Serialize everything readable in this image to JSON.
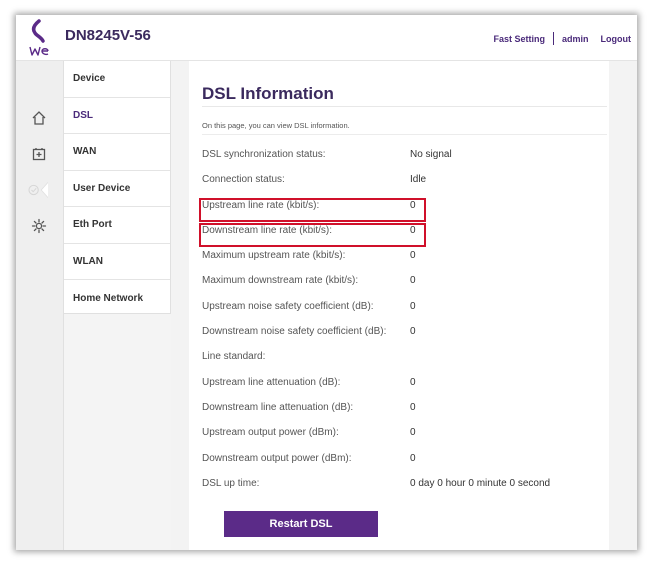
{
  "header": {
    "model": "DN8245V-56",
    "fast_setting": "Fast Setting",
    "user": "admin",
    "logout": "Logout",
    "brand_color": "#5b2b88"
  },
  "rail": {
    "icons": [
      "home-icon",
      "add-device-icon",
      "check-icon",
      "gear-icon"
    ]
  },
  "menu": {
    "items": [
      {
        "label": "Device",
        "active": false
      },
      {
        "label": "DSL",
        "active": true
      },
      {
        "label": "WAN",
        "active": false
      },
      {
        "label": "User Device",
        "active": false
      },
      {
        "label": "Eth Port",
        "active": false
      },
      {
        "label": "WLAN",
        "active": false
      },
      {
        "label": "Home Network",
        "active": false
      }
    ]
  },
  "main": {
    "title": "DSL Information",
    "description": "On this page, you can view DSL information.",
    "rows": [
      {
        "label": "DSL synchronization status:",
        "value": "No signal"
      },
      {
        "label": "Connection status:",
        "value": "Idle"
      },
      {
        "label": "Upstream line rate (kbit/s):",
        "value": "0"
      },
      {
        "label": "Downstream line rate (kbit/s):",
        "value": "0"
      },
      {
        "label": "Maximum upstream rate (kbit/s):",
        "value": "0"
      },
      {
        "label": "Maximum downstream rate (kbit/s):",
        "value": "0"
      },
      {
        "label": "Upstream noise safety coefficient (dB):",
        "value": "0"
      },
      {
        "label": "Downstream noise safety coefficient (dB):",
        "value": "0"
      },
      {
        "label": "Line standard:",
        "value": ""
      },
      {
        "label": "Upstream line attenuation (dB):",
        "value": "0"
      },
      {
        "label": "Downstream line attenuation (dB):",
        "value": "0"
      },
      {
        "label": "Upstream output power (dBm):",
        "value": "0"
      },
      {
        "label": "Downstream output power (dBm):",
        "value": "0"
      },
      {
        "label": "DSL up time:",
        "value": "0 day 0 hour 0 minute 0 second"
      }
    ],
    "restart_label": "Restart DSL",
    "highlight_color": "#d0102a"
  }
}
